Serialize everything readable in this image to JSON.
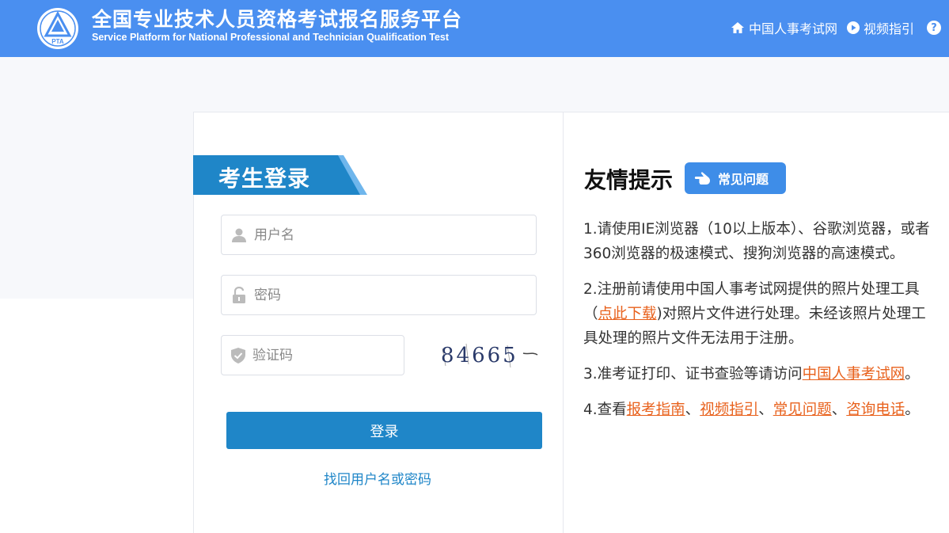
{
  "header": {
    "title_cn": "全国专业技术人员资格考试报名服务平台",
    "title_en": "Service Platform for National Professional and Technician Qualification Test",
    "logo_text": "PTA",
    "links": {
      "home": "中国人事考试网",
      "video": "视频指引"
    },
    "help": "?"
  },
  "login": {
    "title": "考生登录",
    "username_placeholder": "用户名",
    "password_placeholder": "密码",
    "captcha_placeholder": "验证码",
    "captcha_code": "84665",
    "submit": "登录",
    "forgot": "找回用户名或密码"
  },
  "tips": {
    "title": "友情提示",
    "faq_badge": "常见问题",
    "tip1": "1.请使用IE浏览器（10以上版本）、谷歌浏览器，或者360浏览器的极速模式、搜狗浏览器的高速模式。",
    "tip2_pre": "2.注册前请使用中国人事考试网提供的照片处理工具（",
    "tip2_link": "点此下载",
    "tip2_post": ")对照片文件进行处理。未经该照片处理工具处理的照片文件无法用于注册。",
    "tip3_pre": "3.准考证打印、证书查验等请访问",
    "tip3_link": "中国人事考试网",
    "tip3_post": "。",
    "tip4_pre": "4.查看",
    "tip4_link1": "报考指南",
    "tip4_sep1": "、",
    "tip4_link2": "视频指引",
    "tip4_sep2": "、",
    "tip4_link3": "常见问题",
    "tip4_sep3": "、",
    "tip4_link4": "咨询电话",
    "tip4_post": "。"
  },
  "colors": {
    "header_bg": "#4a8ff0",
    "primary": "#1f86c8",
    "link_orange": "#e8611c",
    "banner_blue": "#1f86c8"
  }
}
